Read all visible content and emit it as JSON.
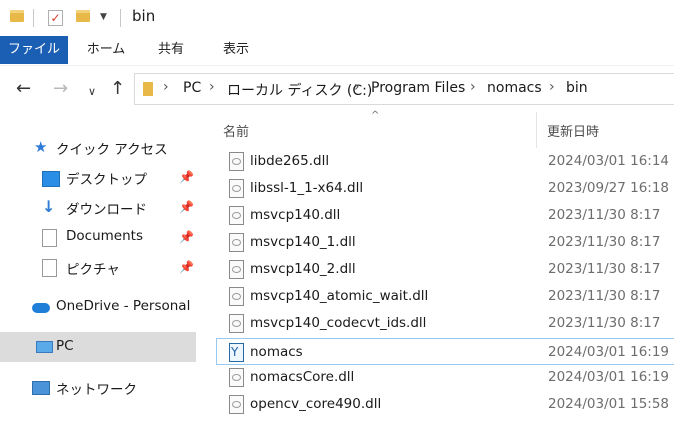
{
  "window": {
    "title": "bin"
  },
  "ribbon": {
    "tabs": [
      {
        "label": "ファイル",
        "active": true
      },
      {
        "label": "ホーム"
      },
      {
        "label": "共有"
      },
      {
        "label": "表示"
      }
    ]
  },
  "address": {
    "crumbs": [
      "PC",
      "ローカル ディスク (C:)",
      "Program Files",
      "nomacs",
      "bin"
    ]
  },
  "nav": {
    "quick_access": "クイック アクセス",
    "desktop": "デスクトップ",
    "downloads": "ダウンロード",
    "documents": "Documents",
    "pictures": "ピクチャ",
    "onedrive": "OneDrive - Personal",
    "pc": "PC",
    "network": "ネットワーク"
  },
  "columns": {
    "name": "名前",
    "date": "更新日時"
  },
  "files": [
    {
      "name": "libde265.dll",
      "date": "2024/03/01 16:14"
    },
    {
      "name": "libssl-1_1-x64.dll",
      "date": "2023/09/27 16:18"
    },
    {
      "name": "msvcp140.dll",
      "date": "2023/11/30 8:17"
    },
    {
      "name": "msvcp140_1.dll",
      "date": "2023/11/30 8:17"
    },
    {
      "name": "msvcp140_2.dll",
      "date": "2023/11/30 8:17"
    },
    {
      "name": "msvcp140_atomic_wait.dll",
      "date": "2023/11/30 8:17"
    },
    {
      "name": "msvcp140_codecvt_ids.dll",
      "date": "2023/11/30 8:17"
    },
    {
      "name": "nomacs",
      "date": "2024/03/01 16:19"
    },
    {
      "name": "nomacsCore.dll",
      "date": "2024/03/01 16:19"
    },
    {
      "name": "opencv_core490.dll",
      "date": "2024/03/01 15:58"
    }
  ],
  "colors": {
    "accent": "#1b5fb4",
    "selected_row_border": "#99c9f1",
    "nav_selected": "#dcdcdc"
  }
}
